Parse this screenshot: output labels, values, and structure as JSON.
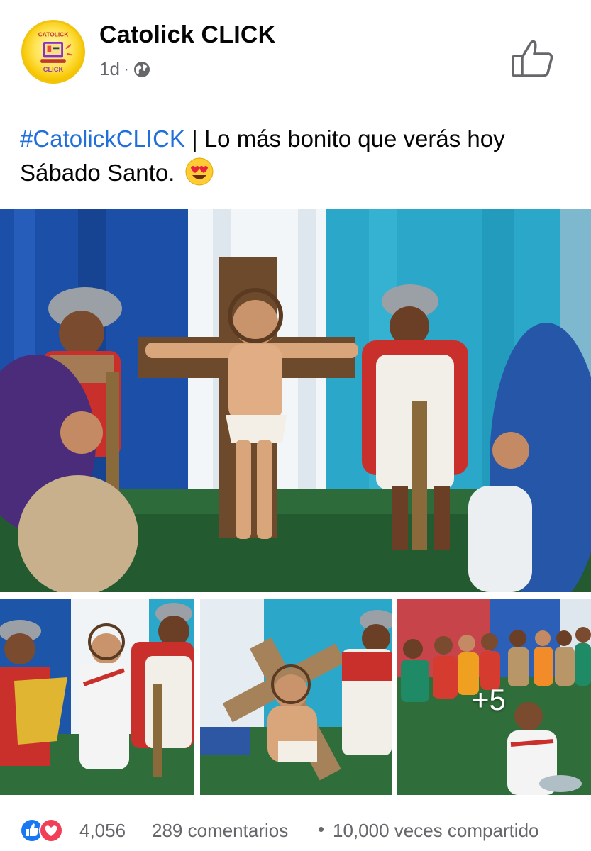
{
  "post": {
    "page_name": "Catolick CLICK",
    "time": "1d",
    "separator": "·",
    "privacy_icon": "globe-icon",
    "avatar_text_top": "CATOLICK",
    "avatar_text_bottom": "CLICK",
    "hashtag": "#CatolickCLICK",
    "caption_text": " | Lo más bonito que verás hoy Sábado Santo.",
    "caption_emoji": "smiling-face-with-heart-eyes-emoji",
    "like_icon": "thumbs-up-icon"
  },
  "gallery": {
    "photos": [
      {
        "description_icon": "crucifixion-play-photo"
      },
      {
        "description_icon": "soldiers-and-jesus-photo"
      },
      {
        "description_icon": "carrying-cross-photo"
      },
      {
        "description_icon": "group-of-children-photo"
      }
    ],
    "more_count_label": "+5"
  },
  "stats": {
    "reaction_icons": [
      "like-reaction-icon",
      "love-reaction-icon"
    ],
    "reaction_count": "4,056",
    "comments": "289 comentarios",
    "separator": "•",
    "shares": "10,000 veces compartido"
  },
  "colors": {
    "hashtag": "#216fdb",
    "secondary_text": "#65676b",
    "like_blue": "#1877f2",
    "love_red": "#f33e58"
  }
}
